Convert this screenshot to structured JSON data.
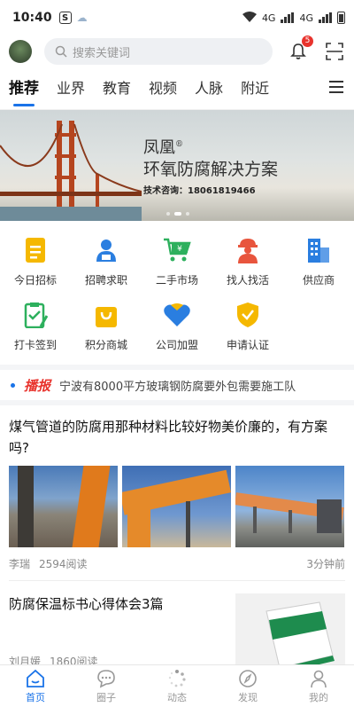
{
  "status_bar": {
    "time": "10:40",
    "app_badge": "S",
    "network1": "4G",
    "network2": "4G"
  },
  "header": {
    "search_placeholder": "搜索关键词",
    "notification_count": "5"
  },
  "tabs": [
    {
      "label": "推荐",
      "active": true
    },
    {
      "label": "业界"
    },
    {
      "label": "教育"
    },
    {
      "label": "视频"
    },
    {
      "label": "人脉"
    },
    {
      "label": "附近"
    }
  ],
  "banner": {
    "title_line1": "凤凰",
    "registered_mark": "®",
    "title_line2": "环氧防腐解决方案",
    "contact": "技术咨询：18061819466",
    "slide_count": 3,
    "active_slide": 2
  },
  "grid": [
    {
      "label": "今日招标",
      "icon": "document-icon",
      "color": "#f5b800"
    },
    {
      "label": "招聘求职",
      "icon": "person-card-icon",
      "color": "#2a7ee0"
    },
    {
      "label": "二手市场",
      "icon": "shopping-cart-icon",
      "color": "#2db05d"
    },
    {
      "label": "找人找活",
      "icon": "worker-icon",
      "color": "#e8553d"
    },
    {
      "label": "供应商",
      "icon": "building-icon",
      "color": "#2a7ee0"
    },
    {
      "label": "打卡签到",
      "icon": "checklist-icon",
      "color": "#2db05d"
    },
    {
      "label": "积分商城",
      "icon": "shopping-bag-icon",
      "color": "#f5b800"
    },
    {
      "label": "公司加盟",
      "icon": "handshake-heart-icon",
      "color": "#2a7ee0"
    },
    {
      "label": "申请认证",
      "icon": "shield-check-icon",
      "color": "#f5b800"
    }
  ],
  "broadcast": {
    "tag": "播报",
    "text": "宁波有8000平方玻璃钢防腐要外包需要施工队"
  },
  "articles": [
    {
      "title": "煤气管道的防腐用那种材料比较好物美价廉的，有方案吗?",
      "author": "李瑞",
      "reads": "2594阅读",
      "time": "3分钟前"
    },
    {
      "title": "防腐保温标书心得体会3篇",
      "author": "刘月媛",
      "reads": "1860阅读"
    }
  ],
  "bottom_nav": [
    {
      "label": "首页",
      "icon": "home-icon",
      "active": true
    },
    {
      "label": "圈子",
      "icon": "chat-bubble-icon"
    },
    {
      "label": "动态",
      "icon": "loading-dots-icon"
    },
    {
      "label": "发现",
      "icon": "compass-icon"
    },
    {
      "label": "我的",
      "icon": "profile-icon"
    }
  ],
  "colors": {
    "accent": "#1a73e8",
    "badge": "#e8332d",
    "broadcast_tag": "#e8332d"
  }
}
